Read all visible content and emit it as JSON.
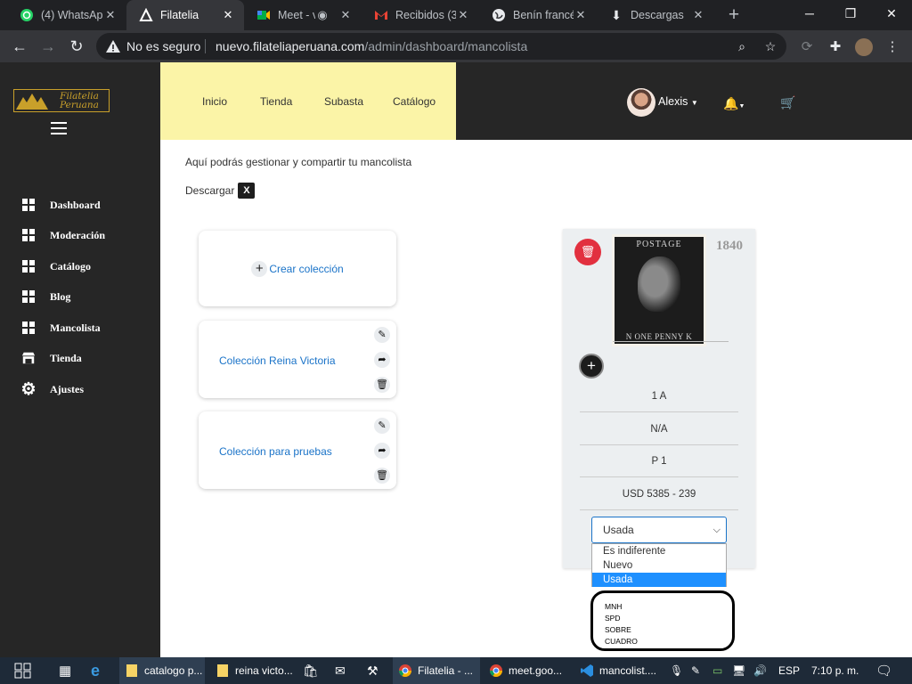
{
  "browser": {
    "tabs": [
      {
        "title": "(4) WhatsApp",
        "icon": "whatsapp-icon",
        "active": false
      },
      {
        "title": "Filatelia",
        "icon": "filatelia-icon",
        "active": true
      },
      {
        "title": "Meet - v",
        "icon": "meet-icon",
        "active": false
      },
      {
        "title": "Recibidos (3",
        "icon": "gmail-icon",
        "active": false
      },
      {
        "title": "Benín francé",
        "icon": "globe-icon",
        "active": false
      },
      {
        "title": "Descargas",
        "icon": "download-icon",
        "active": false
      }
    ],
    "not_secure_label": "No es seguro",
    "url_domain": "nuevo.filateliaperuana.com",
    "url_path": "/admin/dashboard/mancolista"
  },
  "sidebar": {
    "logo_line1": "Filatelia",
    "logo_line2": "Peruana",
    "items": [
      {
        "label": "Dashboard",
        "icon": "grid-icon"
      },
      {
        "label": "Moderación",
        "icon": "grid-icon"
      },
      {
        "label": "Catálogo",
        "icon": "grid-icon"
      },
      {
        "label": "Blog",
        "icon": "grid-icon"
      },
      {
        "label": "Mancolista",
        "icon": "grid-icon"
      },
      {
        "label": "Tienda",
        "icon": "store-icon"
      },
      {
        "label": "Ajustes",
        "icon": "gear-icon"
      }
    ]
  },
  "topnav": {
    "links": [
      "Inicio",
      "Tienda",
      "Subasta",
      "Catálogo"
    ],
    "user_name": "Alexis"
  },
  "main": {
    "intro": "Aquí podrás gestionar y compartir tu mancolista",
    "download_label": "Descargar",
    "create_label": "Crear colección",
    "collections": [
      "Colección Reina Victoria",
      "Colección para pruebas"
    ]
  },
  "stamp": {
    "year": "1840",
    "stamp_top_text": "POSTAGE",
    "stamp_bottom_text": "ONE PENNY",
    "stamp_corner_left": "N",
    "stamp_corner_right": "K",
    "catalog_number": "1 A",
    "variant": "N/A",
    "plate": "P 1",
    "price": "USD 5385 - 239",
    "condition_selected": "Usada",
    "condition_options": [
      "Es indiferente",
      "Nuevo",
      "Usada"
    ],
    "annotation_lines": [
      "MNH",
      "SPD",
      "SOBRE",
      "CUADRO"
    ]
  },
  "taskbar": {
    "items": [
      {
        "label": "catalogo p...",
        "icon": "folder-icon"
      },
      {
        "label": "reina victo...",
        "icon": "folder-icon"
      },
      {
        "label": "Filatelia - ...",
        "icon": "chrome-icon"
      },
      {
        "label": "meet.goo...",
        "icon": "chrome-icon"
      },
      {
        "label": "mancolist....",
        "icon": "vscode-icon"
      }
    ],
    "language": "ESP",
    "time": "7:10 p. m."
  }
}
